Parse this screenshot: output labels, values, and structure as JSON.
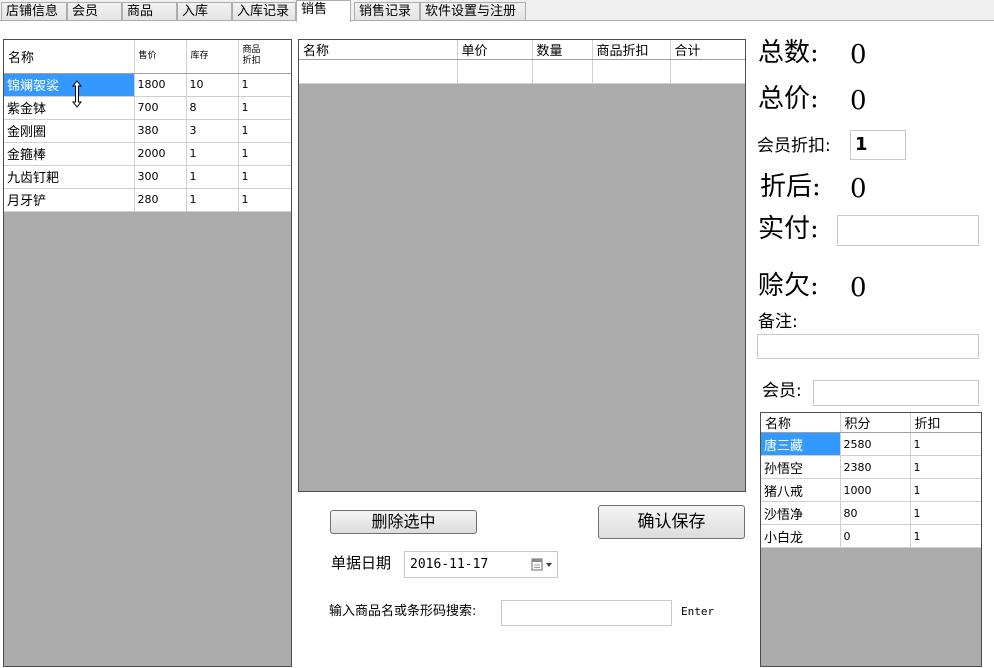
{
  "tabs": [
    {
      "label": "店铺信息"
    },
    {
      "label": "会员"
    },
    {
      "label": "商品"
    },
    {
      "label": "入库"
    },
    {
      "label": "入库记录"
    },
    {
      "label": "销售"
    },
    {
      "label": "销售记录"
    },
    {
      "label": "软件设置与注册"
    }
  ],
  "active_tab": "销售",
  "product_grid": {
    "columns": [
      "名称",
      "售价",
      "库存",
      "商品折扣"
    ],
    "column_header_lines": [
      [
        "名称"
      ],
      [
        "售价"
      ],
      [
        "库存"
      ],
      [
        "商品",
        "折扣"
      ]
    ],
    "rows": [
      {
        "name": "锦斓袈裟",
        "price": "1800",
        "stock": "10",
        "discount": "1"
      },
      {
        "name": "紫金钵",
        "price": "700",
        "stock": "8",
        "discount": "1"
      },
      {
        "name": "金刚圈",
        "price": "380",
        "stock": "3",
        "discount": "1"
      },
      {
        "name": "金箍棒",
        "price": "2000",
        "stock": "1",
        "discount": "1"
      },
      {
        "name": "九齿钉耙",
        "price": "300",
        "stock": "1",
        "discount": "1"
      },
      {
        "name": "月牙铲",
        "price": "280",
        "stock": "1",
        "discount": "1"
      }
    ],
    "selected_row": 0
  },
  "cart_grid": {
    "columns": [
      "名称",
      "单价",
      "数量",
      "商品折扣",
      "合计"
    ]
  },
  "buttons": {
    "delete_selected": "删除选中",
    "confirm_save": "确认保存"
  },
  "bill_date": {
    "label": "单据日期",
    "value": "2016-11-17"
  },
  "search": {
    "label": "输入商品名或条形码搜索:",
    "value": "",
    "hint": "Enter"
  },
  "summary": {
    "total_count_label": "总数:",
    "total_count_value": "0",
    "total_price_label": "总价:",
    "total_price_value": "0",
    "member_discount_label": "会员折扣:",
    "member_discount_value": "1",
    "after_discount_label": "折后:",
    "after_discount_value": "0",
    "paid_label": "实付:",
    "paid_value": "",
    "credit_label": "赊欠:",
    "credit_value": "0",
    "remark_label": "备注:",
    "remark_value": "",
    "member_label": "会员:",
    "member_value": ""
  },
  "member_grid": {
    "columns": [
      "名称",
      "积分",
      "折扣"
    ],
    "rows": [
      {
        "name": "唐三藏",
        "points": "2580",
        "discount": "1"
      },
      {
        "name": "孙悟空",
        "points": "2380",
        "discount": "1"
      },
      {
        "name": "猪八戒",
        "points": "1000",
        "discount": "1"
      },
      {
        "name": "沙悟净",
        "points": "80",
        "discount": "1"
      },
      {
        "name": "小白龙",
        "points": "0",
        "discount": "1"
      }
    ],
    "selected_row": 0
  },
  "icons": {
    "calendar": "calendar-icon",
    "dropdown": "chevron-down-icon",
    "cursor": "resize-cursor-icon"
  },
  "colors": {
    "selection": "#3399ff",
    "grid_background": "#ababab",
    "panel": "#ffffff",
    "window": "#f0f0f0"
  }
}
